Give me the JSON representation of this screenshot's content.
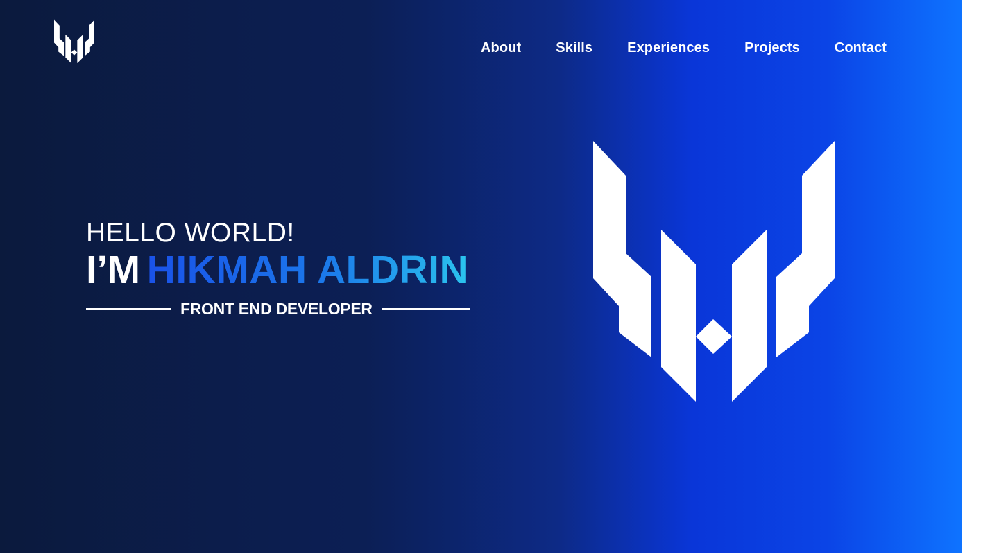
{
  "brand": {
    "logo_icon": "hm-monogram-logo",
    "accent": "#1a52e8",
    "accent_light": "#2bc4ee"
  },
  "nav": {
    "items": [
      {
        "label": "About"
      },
      {
        "label": "Skills"
      },
      {
        "label": "Experiences"
      },
      {
        "label": "Projects"
      },
      {
        "label": "Contact"
      }
    ]
  },
  "hero": {
    "greeting": "HELLO WORLD!",
    "intro": "I’M",
    "name": "HIKMAH ALDRIN",
    "role": "FRONT END DEVELOPER"
  }
}
